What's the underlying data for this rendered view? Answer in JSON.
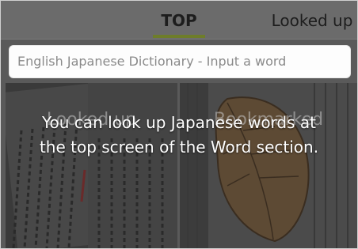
{
  "tabs": {
    "top_label": "TOP",
    "looked_up_label": "Looked up",
    "accent_color": "#6e7d2a"
  },
  "search": {
    "placeholder": "English Japanese Dictionary - Input a word"
  },
  "panels": {
    "left_label": "Looked up",
    "right_label": "Bookmarked"
  },
  "tutorial": {
    "line1": "You can look up Japanese words at",
    "line2": "the top screen of the Word section."
  }
}
